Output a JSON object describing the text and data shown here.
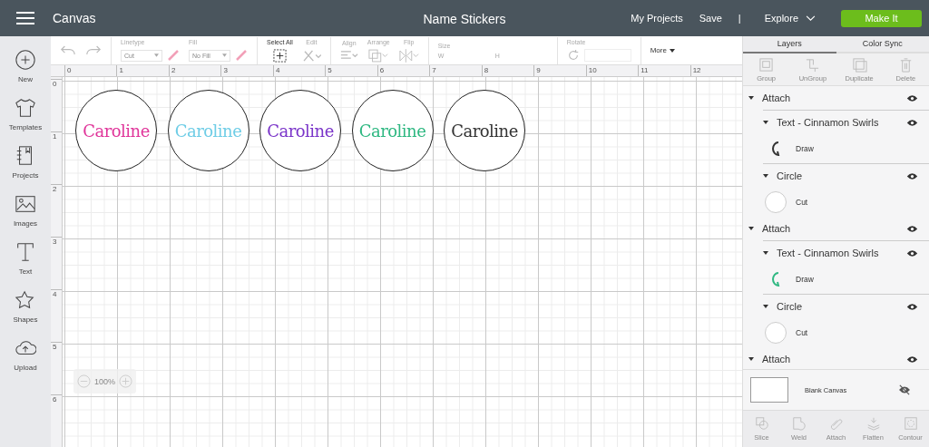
{
  "top_bar": {
    "section": "Canvas",
    "document_title": "Name Stickers",
    "links": [
      "My Projects",
      "Save"
    ],
    "separator": "|",
    "explore": "Explore",
    "make_it": "Make It"
  },
  "sidebar": {
    "items": [
      {
        "kind": "new",
        "label": "New"
      },
      {
        "kind": "templates",
        "label": "Templates"
      },
      {
        "kind": "projects",
        "label": "Projects"
      },
      {
        "kind": "images",
        "label": "Images"
      },
      {
        "kind": "text",
        "label": "Text"
      },
      {
        "kind": "shapes",
        "label": "Shapes"
      },
      {
        "kind": "upload",
        "label": "Upload"
      }
    ]
  },
  "toolbar": {
    "linetype": {
      "label": "Linetype",
      "value": "Cut"
    },
    "fill": {
      "label": "Fill",
      "value": "No Fill"
    },
    "select_all": "Select All",
    "edit": "Edit",
    "align": "Align",
    "arrange": "Arrange",
    "flip": "Flip",
    "size": {
      "label": "Size",
      "w": "W",
      "h": "H"
    },
    "rotate": "Rotate",
    "more": "More"
  },
  "rulers": {
    "horizontal": [
      "0",
      "1",
      "2",
      "3",
      "4",
      "5",
      "6",
      "7",
      "8",
      "9",
      "10",
      "11",
      "12"
    ],
    "vertical": [
      "0",
      "1",
      "2",
      "3",
      "4",
      "5",
      "6"
    ]
  },
  "stickers": [
    {
      "text": "Caroline",
      "color": "#e0359a"
    },
    {
      "text": "Caroline",
      "color": "#6fcde6"
    },
    {
      "text": "Caroline",
      "color": "#7a34c9"
    },
    {
      "text": "Caroline",
      "color": "#2fb882"
    },
    {
      "text": "Caroline",
      "color": "#333333"
    }
  ],
  "zoom": "100%",
  "panel": {
    "tabs": [
      {
        "label": "Layers",
        "selected": true
      },
      {
        "label": "Color Sync",
        "selected": false
      }
    ],
    "tools": [
      {
        "kind": "group",
        "label": "Group"
      },
      {
        "kind": "ungroup",
        "label": "UnGroup"
      },
      {
        "kind": "duplicate",
        "label": "Duplicate"
      },
      {
        "kind": "delete",
        "label": "Delete"
      }
    ],
    "layers": [
      {
        "label": "Attach",
        "children": [
          {
            "label": "Text - Cinnamon Swirls",
            "operation": "Draw",
            "kind": "text",
            "color": "#333333"
          },
          {
            "label": "Circle",
            "operation": "Cut",
            "kind": "circle"
          }
        ]
      },
      {
        "label": "Attach",
        "children": [
          {
            "label": "Text - Cinnamon Swirls",
            "operation": "Draw",
            "kind": "text",
            "color": "#2fb882"
          },
          {
            "label": "Circle",
            "operation": "Cut",
            "kind": "circle"
          }
        ]
      },
      {
        "label": "Attach"
      }
    ],
    "blank_canvas": {
      "label": "Blank Canvas",
      "visible": false
    },
    "bottom_tools": [
      {
        "kind": "slice",
        "label": "Slice"
      },
      {
        "kind": "weld",
        "label": "Weld"
      },
      {
        "kind": "attach",
        "label": "Attach"
      },
      {
        "kind": "flatten",
        "label": "Flatten"
      },
      {
        "kind": "contour",
        "label": "Contour"
      }
    ]
  }
}
